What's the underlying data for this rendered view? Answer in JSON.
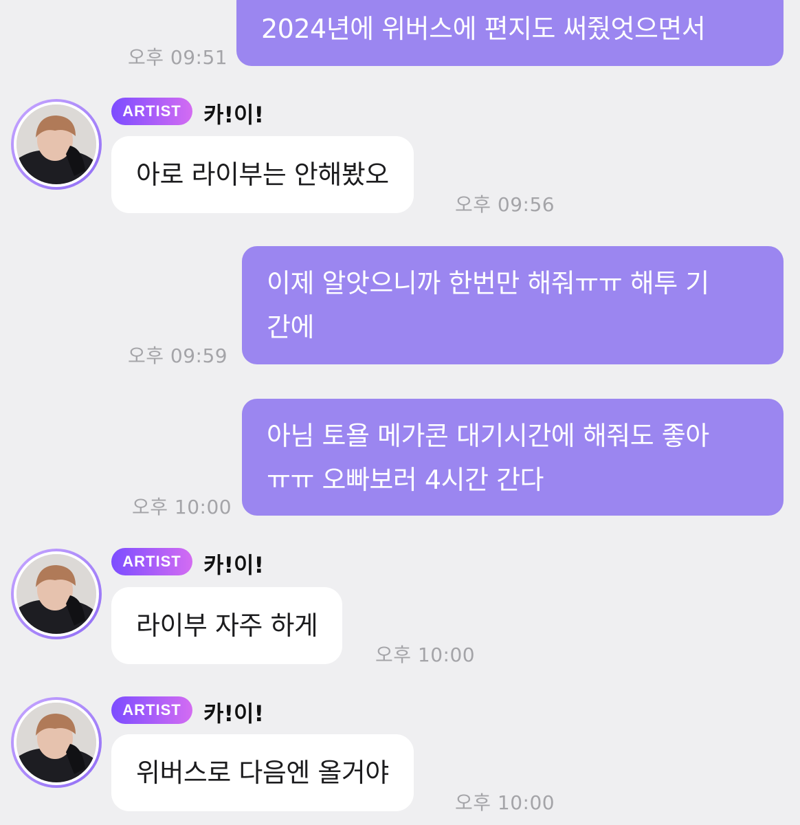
{
  "messages": [
    {
      "type": "sent",
      "lines": [
        "2024년에 위버스에 편지도 써줬엇으면서"
      ],
      "time": "오후 09:51"
    },
    {
      "type": "received",
      "badge": "ARTIST",
      "sender": "카!이!",
      "text": "아로 라이부는 안해봤오",
      "time": "오후 09:56"
    },
    {
      "type": "sent",
      "lines": [
        "이제 알앗으니까 한번만 해줘ㅠㅠ 해투 기",
        "간에"
      ],
      "time": "오후 09:59"
    },
    {
      "type": "sent",
      "lines": [
        "아님 토욜 메가콘 대기시간에 해줘도 좋아",
        "ㅠㅠ 오빠보러 4시간 간다"
      ],
      "time": "오후 10:00"
    },
    {
      "type": "received",
      "badge": "ARTIST",
      "sender": "카!이!",
      "text": "라이부 자주 하게",
      "time": "오후 10:00"
    },
    {
      "type": "received",
      "badge": "ARTIST",
      "sender": "카!이!",
      "text": "위버스로 다음엔 올거야",
      "time": "오후 10:00"
    }
  ],
  "colors": {
    "background": "#efeff1",
    "sent_bubble": "#9b86f0",
    "received_bubble": "#ffffff",
    "badge_gradient_start": "#7c4dff",
    "badge_gradient_end": "#d36cf2",
    "timestamp": "#a4a4a8"
  }
}
